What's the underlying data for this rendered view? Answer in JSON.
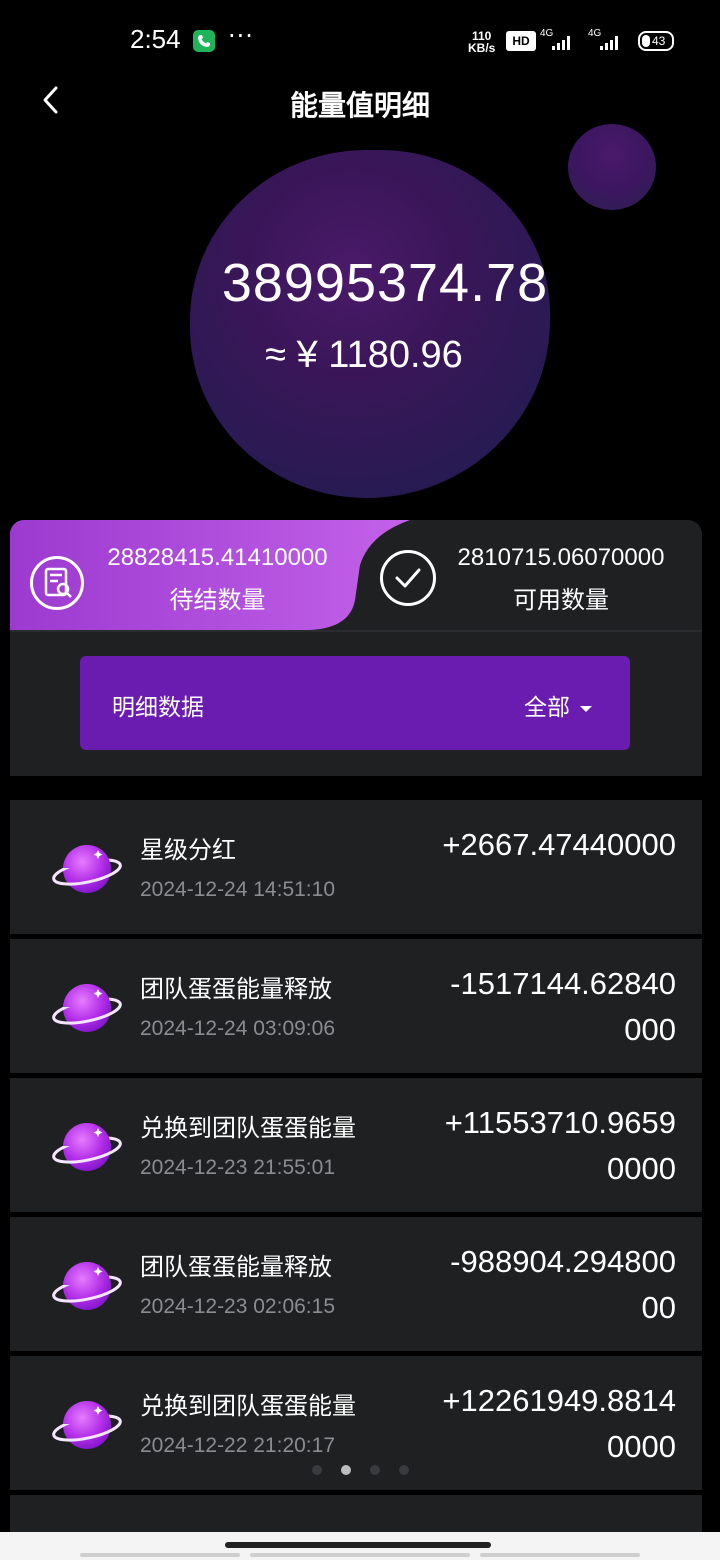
{
  "status_bar": {
    "time": "2:54",
    "net_speed_value": "110",
    "net_speed_unit": "KB/s",
    "hd_label": "HD",
    "network_1": "4G",
    "network_2": "4G",
    "battery": "43",
    "more_label": "···"
  },
  "nav": {
    "title": "能量值明细"
  },
  "hero": {
    "balance": "38995374.78",
    "cny_equivalent": "≈ ¥ 1180.96"
  },
  "summary": {
    "pending_value": "28828415.41410000",
    "pending_label": "待结数量",
    "available_value": "2810715.06070000",
    "available_label": "可用数量"
  },
  "filter": {
    "label": "明细数据",
    "selected": "全部"
  },
  "records": [
    {
      "title": "星级分红",
      "time": "2024-12-24 14:51:10",
      "amount": "+2667.47440000"
    },
    {
      "title": "团队蛋蛋能量释放",
      "time": "2024-12-24 03:09:06",
      "amount": "-1517144.62840000"
    },
    {
      "title": "兑换到团队蛋蛋能量",
      "time": "2024-12-23 21:55:01",
      "amount": "+11553710.96590000"
    },
    {
      "title": "团队蛋蛋能量释放",
      "time": "2024-12-23 02:06:15",
      "amount": "-988904.29480000"
    },
    {
      "title": "兑换到团队蛋蛋能量",
      "time": "2024-12-22 21:20:17",
      "amount": "+12261949.88140000"
    }
  ],
  "pager": {
    "count": 4,
    "active_index": 1
  },
  "colors": {
    "accent_purple": "#6a1cb0",
    "pending_gradient_start": "#9c3ad0",
    "pending_gradient_end": "#c261e8",
    "card_bg": "#1f2022",
    "muted_text": "#8b8c90"
  }
}
